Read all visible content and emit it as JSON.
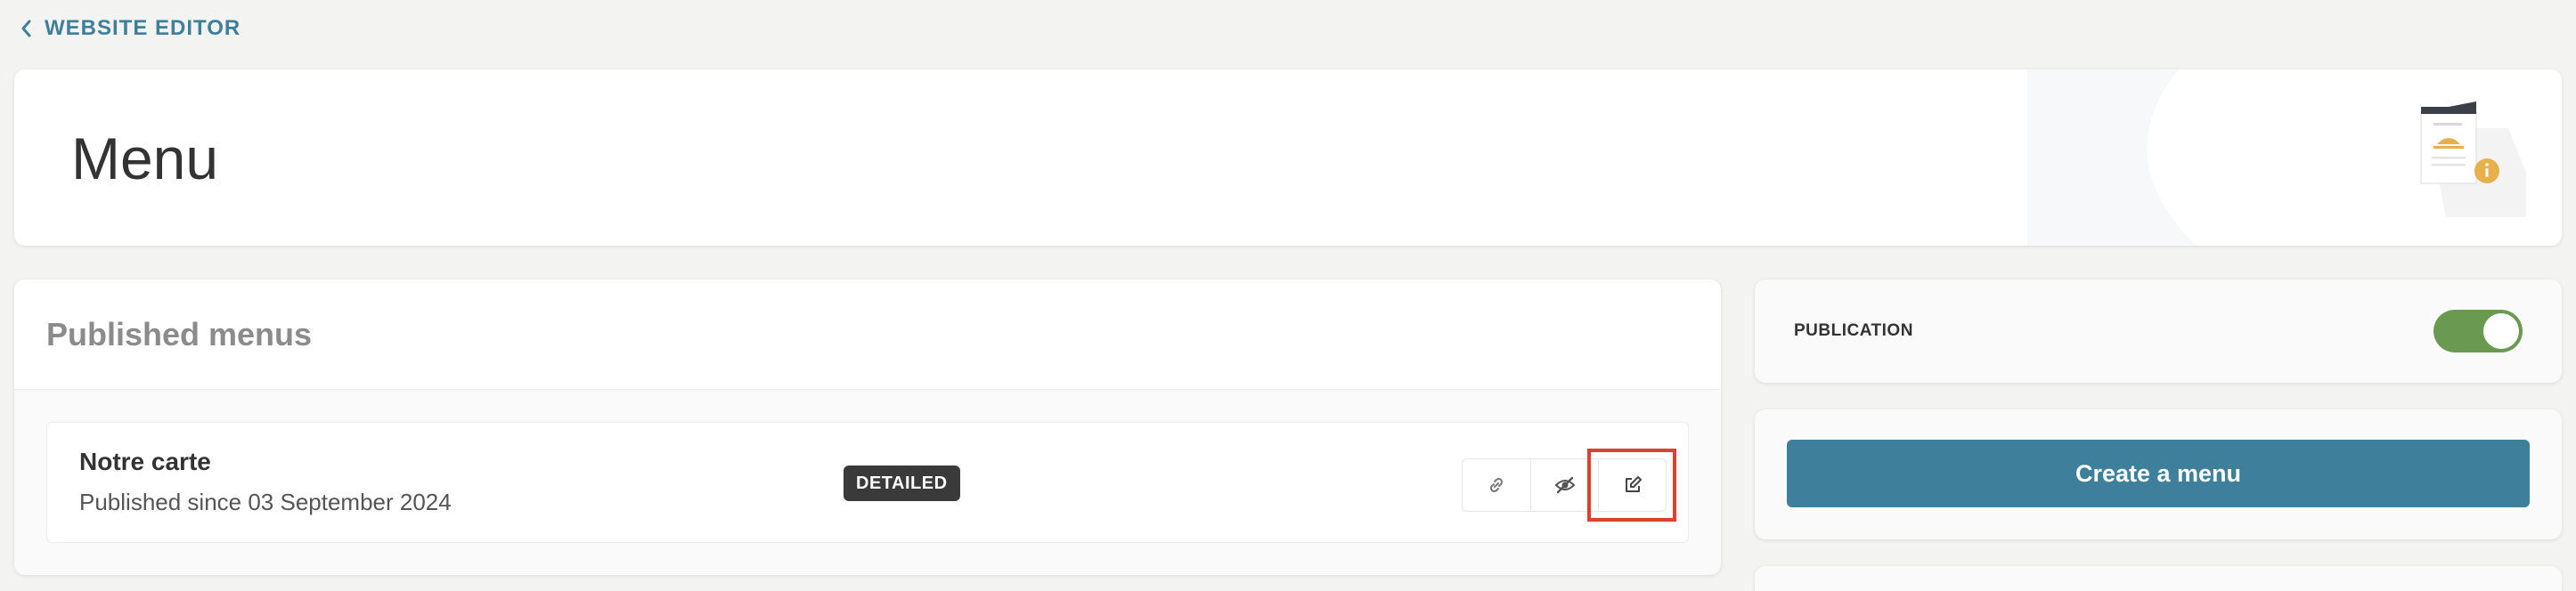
{
  "breadcrumb": {
    "label": "WEBSITE EDITOR",
    "icon": "chevron-left-icon"
  },
  "header": {
    "title": "Menu",
    "illustration_icon": "menu-info-illustration"
  },
  "published": {
    "title": "Published menus",
    "items": [
      {
        "name": "Notre carte",
        "status": "Published since 03 September 2024",
        "badge": "DETAILED",
        "actions": [
          "link-icon",
          "eye-slash-icon",
          "edit-icon"
        ]
      }
    ]
  },
  "publication": {
    "label": "PUBLICATION",
    "enabled": true
  },
  "create": {
    "label": "Create a menu"
  },
  "colors": {
    "accent": "#3e7f9b",
    "toggle_on": "#6a9a52",
    "badge": "#3a3a3a",
    "highlight": "#d9432e",
    "background": "#f3f3f1"
  }
}
